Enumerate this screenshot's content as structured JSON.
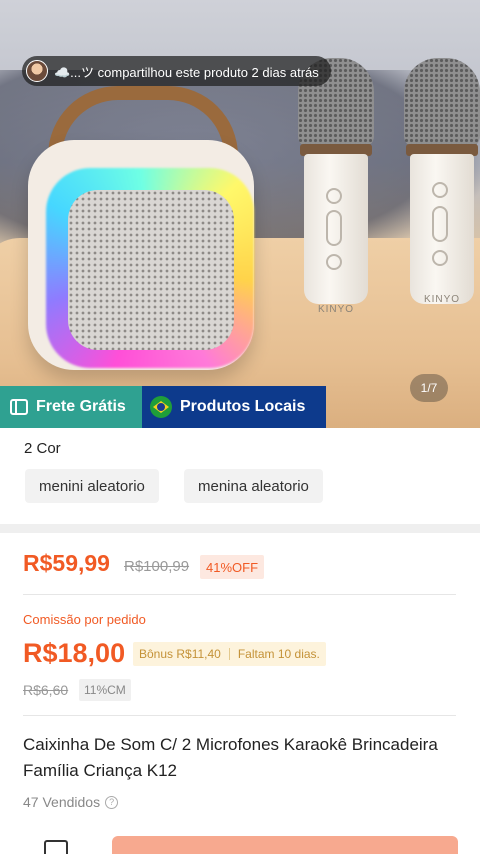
{
  "hero": {
    "share_text": "☁️...ツ compartilhou este produto 2 dias atrás",
    "image_counter": "1/7",
    "mic_brand": "KINYO",
    "badges": {
      "frete": "Frete Grátis",
      "locais": "Produtos Locais"
    }
  },
  "variants": {
    "title": "2 Cor",
    "options": [
      "menini aleatorio",
      "menina aleatorio"
    ]
  },
  "price": {
    "current": "R$59,99",
    "original": "R$100,99",
    "discount": "41%OFF"
  },
  "commission": {
    "label": "Comissão por pedido",
    "value": "R$18,00",
    "bonus": "Bônus R$11,40",
    "remaining": "Faltam 10 dias.",
    "old_value": "R$6,60",
    "rate": "11%CM"
  },
  "product": {
    "title": "Caixinha De Som C/ 2 Microfones Karaokê Brincadeira Família Criança K12",
    "sold": "47 Vendidos"
  },
  "colors": {
    "accent": "#f15a24",
    "frete_bg": "#2fa191",
    "locais_bg": "#0d3a8c"
  }
}
